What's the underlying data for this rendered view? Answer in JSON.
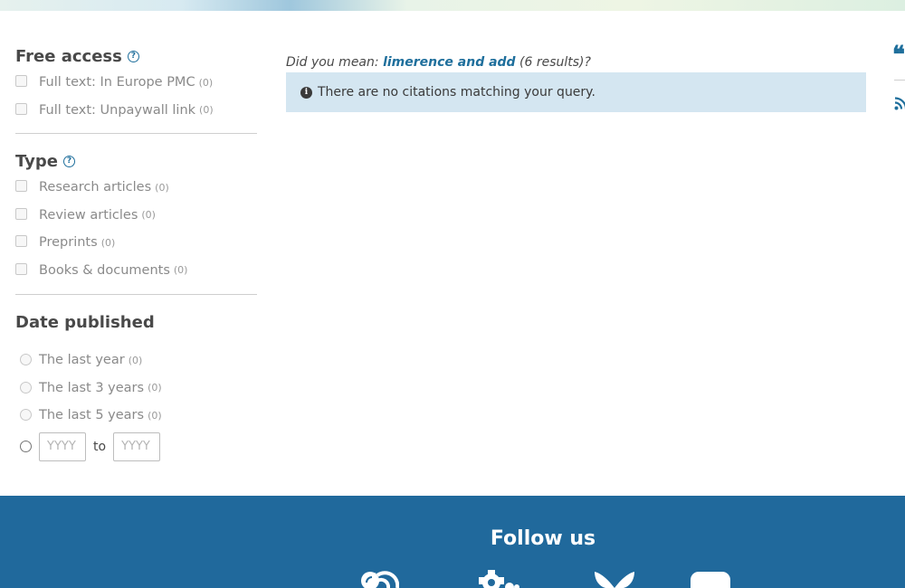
{
  "facets": {
    "free_access": {
      "title": "Free access",
      "items": [
        {
          "label": "Full text: In Europe PMC",
          "count": "(0)"
        },
        {
          "label": "Full text: Unpaywall link",
          "count": "(0)"
        }
      ]
    },
    "type": {
      "title": "Type",
      "items": [
        {
          "label": "Research articles",
          "count": "(0)"
        },
        {
          "label": "Review articles",
          "count": "(0)"
        },
        {
          "label": "Preprints",
          "count": "(0)"
        },
        {
          "label": "Books & documents",
          "count": "(0)"
        }
      ]
    },
    "date_published": {
      "title": "Date published",
      "items": [
        {
          "label": "The last year",
          "count": "(0)"
        },
        {
          "label": "The last 3 years",
          "count": "(0)"
        },
        {
          "label": "The last 5 years",
          "count": "(0)"
        }
      ],
      "from_placeholder": "YYYY",
      "to_label": "to",
      "to_placeholder": "YYYY"
    }
  },
  "help_glyph": "?",
  "suggestion": {
    "prefix": "Did you mean:",
    "link_text": "limerence and add",
    "suffix": "(6 results)?"
  },
  "notice": {
    "icon_glyph": "i",
    "text": "There are no citations matching your query."
  },
  "right_tools": {
    "quote_glyph": "❝"
  },
  "footer": {
    "follow_title": "Follow us",
    "icons": [
      "blog-icon",
      "gear-icon",
      "bluesky-icon",
      "youtube-icon"
    ]
  },
  "colors": {
    "accent": "#1f6f9c",
    "footer_bg": "#20699c",
    "notice_bg": "#d4e6f1"
  }
}
